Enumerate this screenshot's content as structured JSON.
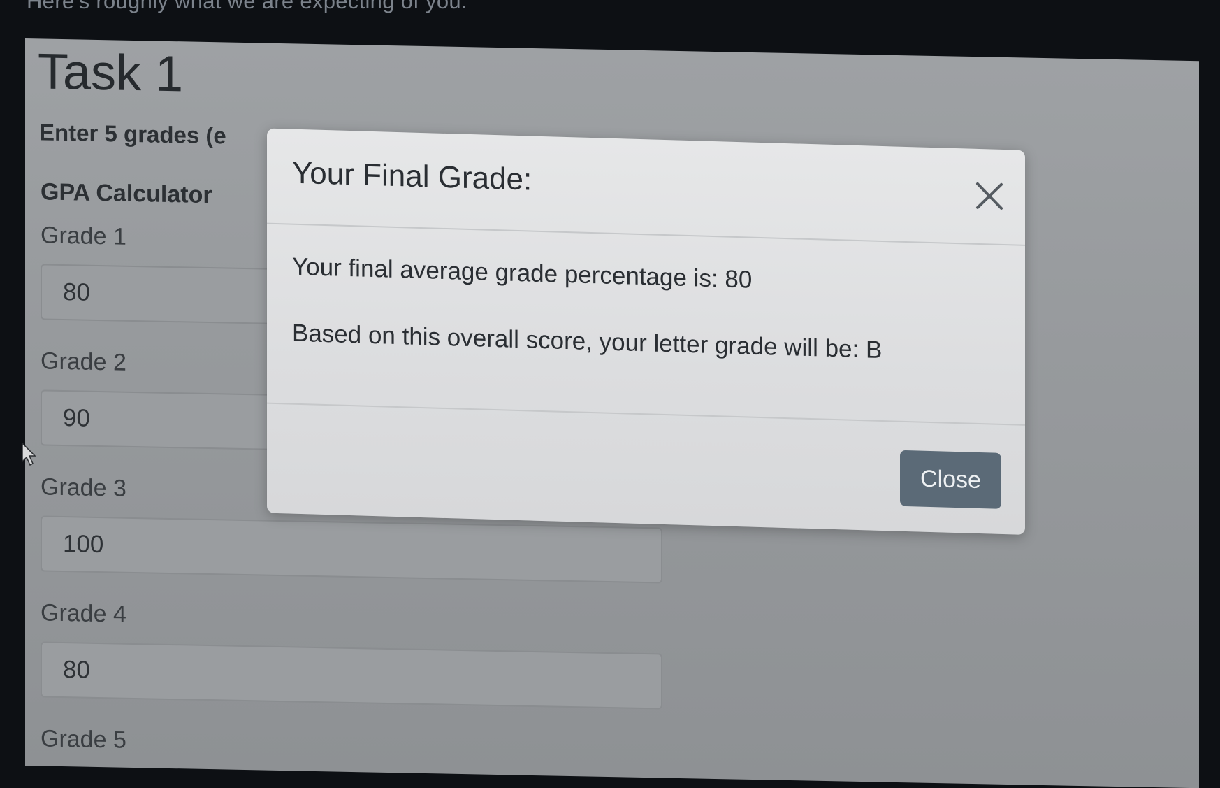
{
  "caption": "Here's roughly what we are expecting of you:",
  "page": {
    "task_title": "Task 1",
    "instructions": "Enter 5 grades (e",
    "section_title": "GPA Calculator",
    "grades": [
      {
        "label": "Grade 1",
        "value": "80"
      },
      {
        "label": "Grade 2",
        "value": "90"
      },
      {
        "label": "Grade 3",
        "value": "100"
      },
      {
        "label": "Grade 4",
        "value": "80"
      },
      {
        "label": "Grade 5",
        "value": ""
      }
    ]
  },
  "modal": {
    "title": "Your Final Grade:",
    "average_text": "Your final average grade percentage is: 80",
    "letter_text": "Based on this overall score, your letter grade will be: B",
    "close_label": "Close",
    "close_icon": "close-x-icon"
  },
  "colors": {
    "close_button": "#5b6a77",
    "modal_background": "#e2e3e4",
    "overlay_page": "#9a9da0"
  }
}
